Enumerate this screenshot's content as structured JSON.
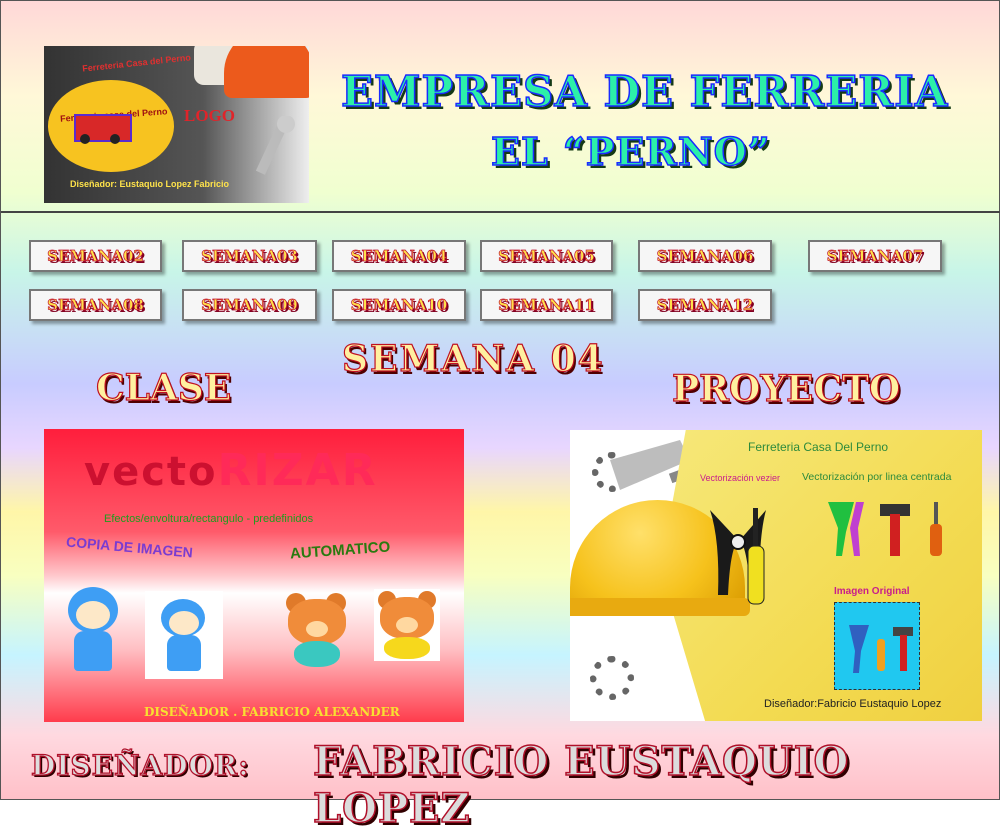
{
  "header": {
    "title_line1": "EMPRESA DE FERRERIA",
    "title_line2": "EL    “PERNO”",
    "logo": {
      "arc_text": "Ferreteria Casa del Perno",
      "ellipse_text": "Ferreteria casa del Perno",
      "logo_word": "LOGO",
      "designer_text": "Diseñador: Eustaquio Lopez Fabricio"
    }
  },
  "weeks": {
    "buttons": [
      "SEMANA02",
      "SEMANA03",
      "SEMANA04",
      "SEMANA05",
      "SEMANA06",
      "SEMANA07",
      "SEMANA08",
      "SEMANA09",
      "SEMANA10",
      "SEMANA11",
      "SEMANA12"
    ]
  },
  "section": {
    "current_week": "SEMANA 04",
    "clase_label": "CLASE",
    "proyecto_label": "PROYECTO"
  },
  "class_panel": {
    "title_part1": "vecto",
    "title_part2": "RIZAR",
    "effects_text": "Efectos/envoltura/rectangulo - predefinidos",
    "copy_text": "COPIA DE IMAGEN",
    "auto_text": "AUTOMATICO",
    "designer_text": "DISEÑADOR . FABRICIO ALEXANDER"
  },
  "project_panel": {
    "title": "Ferreteria Casa Del Perno",
    "vector_bezier_label": "Vectorización vezier",
    "vector_line_label": "Vectorización por linea centrada",
    "original_label": "Imagen Original",
    "designer_text": "Diseñador:Fabricio Eustaquio Lopez"
  },
  "footer": {
    "label": "DISEÑADOR:",
    "name": "FABRICIO EUSTAQUIO LOPEZ"
  },
  "colors": {
    "title_fill": "#2cf0a8",
    "title_stroke": "#1a2aff",
    "button_text": "#ffe24a",
    "button_stroke": "#c01030",
    "accent_red": "#c01020"
  }
}
